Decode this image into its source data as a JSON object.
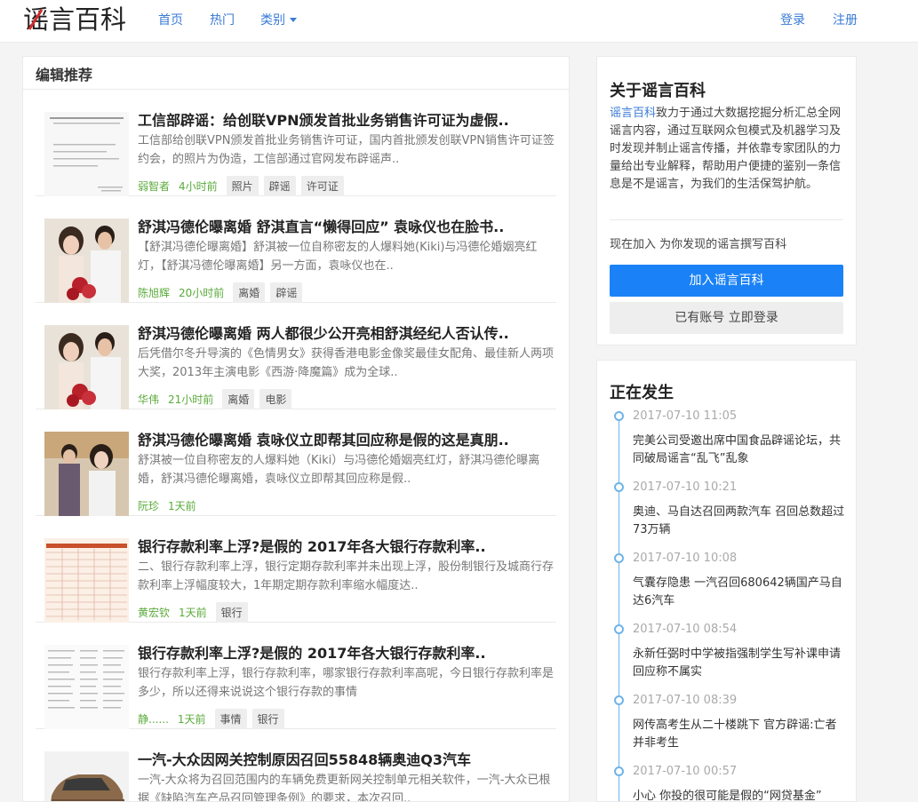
{
  "header": {
    "logo_text": "谣言百科",
    "nav": {
      "home": "首页",
      "hot": "热门",
      "category": "类别"
    },
    "login": "登录",
    "register": "注册"
  },
  "main": {
    "section_title": "编辑推荐",
    "items": [
      {
        "title": "工信部辟谣：给创联VPN颁发首批业务销售许可证为虚假..",
        "desc": "工信部给创联VPN颁发首批业务销售许可证，国内首批颁发创联VPN销售许可证签约会，的照片为伪造，工信部通过官网发布辟谣声..",
        "author": "弱智者",
        "time": "4小时前",
        "tags": [
          "照片",
          "辟谣",
          "许可证"
        ]
      },
      {
        "title": "舒淇冯德伦曝离婚 舒淇直言“懒得回应” 袁咏仪也在脸书..",
        "desc": "【舒淇冯德伦曝离婚】舒淇被一位自称密友的人爆料她(Kiki)与冯德伦婚姻亮红灯，【舒淇冯德伦曝离婚】另一方面，袁咏仪也在..",
        "author": "陈旭辉",
        "time": "20小时前",
        "tags": [
          "离婚",
          "辟谣"
        ]
      },
      {
        "title": "舒淇冯德伦曝离婚 两人都很少公开亮相舒淇经纪人否认传..",
        "desc": "后凭借尔冬升导演的《色情男女》获得香港电影金像奖最佳女配角、最佳新人两项大奖，2013年主演电影《西游·降魔篇》成为全球..",
        "author": "华伟",
        "time": "21小时前",
        "tags": [
          "离婚",
          "电影"
        ]
      },
      {
        "title": "舒淇冯德伦曝离婚 袁咏仪立即帮其回应称是假的这是真朋..",
        "desc": "舒淇被一位自称密友的人爆料她（Kiki）与冯德伦婚姻亮红灯，舒淇冯德伦曝离婚，舒淇冯德伦曝离婚，袁咏仪立即帮其回应称是假..",
        "author": "阮珍",
        "time": "1天前",
        "tags": []
      },
      {
        "title": "银行存款利率上浮?是假的 2017年各大银行存款利率..",
        "desc": "二、银行存款利率上浮，银行定期存款利率并未出现上浮，股份制银行及城商行存款利率上浮幅度较大，1年期定期存款利率缩水幅度达..",
        "author": "黄宏钦",
        "time": "1天前",
        "tags": [
          "银行"
        ]
      },
      {
        "title": "银行存款利率上浮?是假的 2017年各大银行存款利率..",
        "desc": "银行存款利率上浮，银行存款利率，哪家银行存款利率高呢，今日银行存款利率是多少，所以还得来说说这个银行存款的事情",
        "author": "静......",
        "time": "1天前",
        "tags": [
          "事情",
          "银行"
        ]
      },
      {
        "title": "一汽-大众因网关控制原因召回55848辆奥迪Q3汽车",
        "desc": "一汽-大众将为召回范围内的车辆免费更新网关控制单元相关软件，一汽-大众已根据《缺陷汽车产品召回管理条例》的要求，本次召回..",
        "author": "",
        "time": "",
        "tags": []
      }
    ]
  },
  "about": {
    "title": "关于谣言百科",
    "brand": "谣言百科",
    "text": "致力于通过大数据挖掘分析汇总全网谣言内容，通过互联网众包模式及机器学习及时发现并制止谣言传播，并依靠专家团队的力量给出专业解释，帮助用户便捷的鉴别一条信息是不是谣言，为我们的生活保驾护航。",
    "join_prompt": "现在加入 为你发现的谣言撰写百科",
    "join_button": "加入谣言百科",
    "login_button": "已有账号 立即登录"
  },
  "happening": {
    "title": "正在发生",
    "items": [
      {
        "time": "2017-07-10 11:05",
        "text": "完美公司受邀出席中国食品辟谣论坛，共同破局谣言“乱飞”乱象"
      },
      {
        "time": "2017-07-10 10:21",
        "text": "奥迪、马自达召回两款汽车 召回总数超过73万辆"
      },
      {
        "time": "2017-07-10 10:08",
        "text": "气囊存隐患 一汽召回680642辆国产马自达6汽车"
      },
      {
        "time": "2017-07-10 08:54",
        "text": "永新任弼时中学被指强制学生写补课申请 回应称不属实"
      },
      {
        "time": "2017-07-10 08:39",
        "text": "网传高考生从二十楼跳下 官方辟谣:亡者并非考生"
      },
      {
        "time": "2017-07-10 00:57",
        "text": "小心 你投的很可能是假的“网贷基金”"
      }
    ]
  },
  "colors": {
    "accent": "#1a82f6",
    "link": "#3a7bd5",
    "author": "#5aaa3a",
    "timeline": "#6fb4e8"
  }
}
